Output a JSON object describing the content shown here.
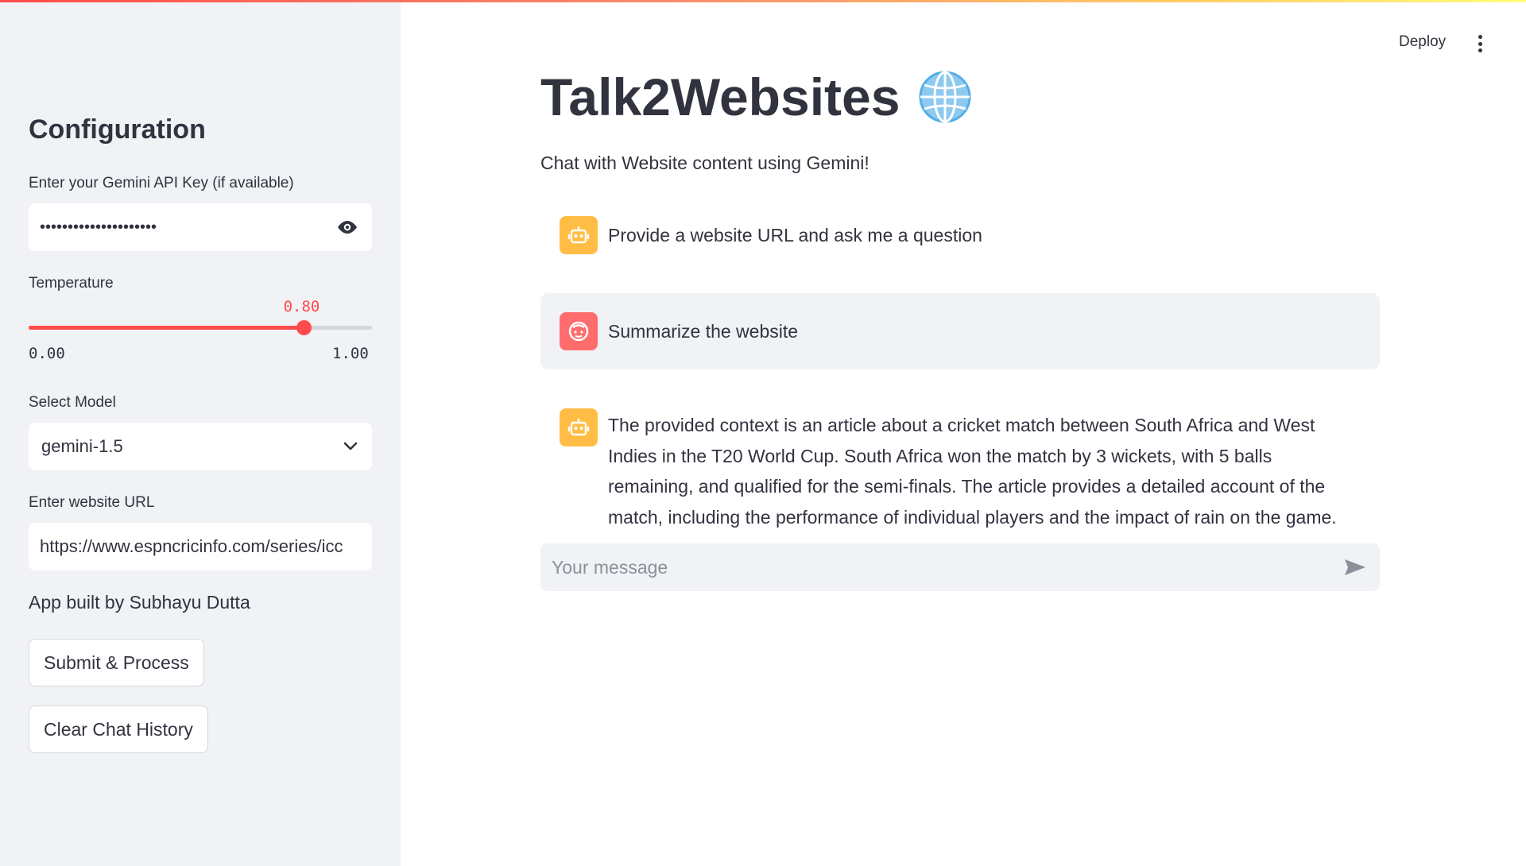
{
  "sidebar": {
    "title": "Configuration",
    "api_key": {
      "label": "Enter your Gemini API Key (if available)",
      "masked_value": "•••••••••••••••••••••"
    },
    "temperature": {
      "label": "Temperature",
      "value": 0.8,
      "value_label": "0.80",
      "min_label": "0.00",
      "max_label": "1.00"
    },
    "model": {
      "label": "Select Model",
      "selected": "gemini-1.5"
    },
    "url": {
      "label": "Enter website URL",
      "value": "https://www.espncricinfo.com/series/icc"
    },
    "credit": "App built by Subhayu Dutta",
    "submit_button": "Submit & Process",
    "clear_button": "Clear Chat History"
  },
  "header": {
    "deploy": "Deploy"
  },
  "main": {
    "title": "Talk2Websites",
    "subtitle": "Chat with Website content using Gemini!",
    "messages": [
      {
        "role": "assistant",
        "text": "Provide a website URL and ask me a question"
      },
      {
        "role": "user",
        "text": "Summarize the website"
      },
      {
        "role": "assistant",
        "text": "The provided context is an article about a cricket match between South Africa and West Indies in the T20 World Cup. South Africa won the match by 3 wickets, with 5 balls remaining, and qualified for the semi-finals. The article provides a detailed account of the match, including the performance of individual players and the impact of rain on the game."
      }
    ],
    "chat_input": {
      "placeholder": "Your message"
    }
  },
  "colors": {
    "accent": "#ff4b4b",
    "bot_avatar": "#ffbd45",
    "user_avatar": "#ff6c6c",
    "sidebar_bg": "#f0f2f6"
  }
}
